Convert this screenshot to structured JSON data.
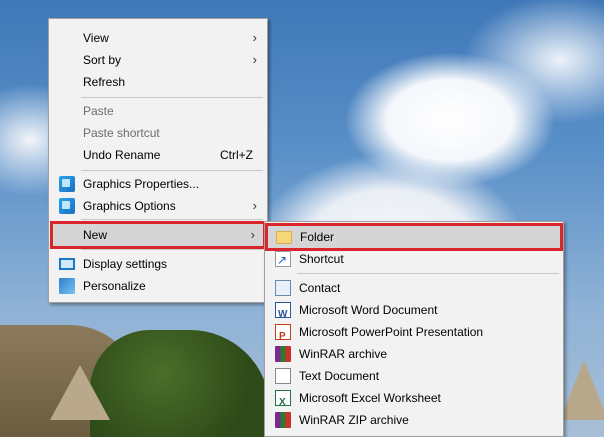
{
  "context_menu": {
    "items": [
      {
        "label": "View",
        "submenu": true
      },
      {
        "label": "Sort by",
        "submenu": true
      },
      {
        "label": "Refresh"
      },
      {
        "label": "Paste",
        "disabled": true
      },
      {
        "label": "Paste shortcut",
        "disabled": true
      },
      {
        "label": "Undo Rename",
        "shortcut": "Ctrl+Z"
      },
      {
        "label": "Graphics Properties...",
        "icon": "graphics-icon"
      },
      {
        "label": "Graphics Options",
        "icon": "graphics-icon",
        "submenu": true
      },
      {
        "label": "New",
        "submenu": true,
        "highlighted": true
      },
      {
        "label": "Display settings",
        "icon": "display-icon"
      },
      {
        "label": "Personalize",
        "icon": "personalize-icon"
      }
    ]
  },
  "new_submenu": {
    "items": [
      {
        "label": "Folder",
        "icon": "folder-icon",
        "highlighted": true
      },
      {
        "label": "Shortcut",
        "icon": "shortcut-icon"
      },
      {
        "label": "Contact",
        "icon": "contact-icon"
      },
      {
        "label": "Microsoft Word Document",
        "icon": "word-icon"
      },
      {
        "label": "Microsoft PowerPoint Presentation",
        "icon": "powerpoint-icon"
      },
      {
        "label": "WinRAR archive",
        "icon": "winrar-icon"
      },
      {
        "label": "Text Document",
        "icon": "text-document-icon"
      },
      {
        "label": "Microsoft Excel Worksheet",
        "icon": "excel-icon"
      },
      {
        "label": "WinRAR ZIP archive",
        "icon": "winrar-zip-icon"
      }
    ]
  },
  "colors": {
    "highlight_border": "#d9262c",
    "menu_bg": "#f2f2f2"
  }
}
